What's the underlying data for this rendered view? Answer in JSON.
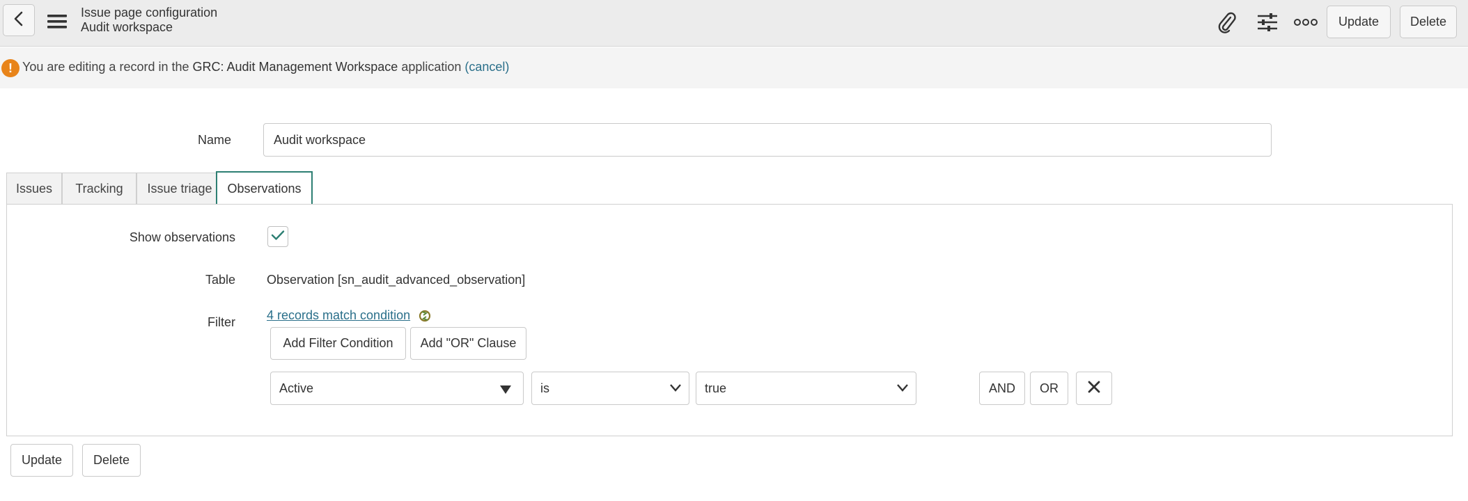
{
  "header": {
    "title": "Issue page configuration",
    "subtitle": "Audit workspace",
    "update_label": "Update",
    "delete_label": "Delete"
  },
  "notice": {
    "prefix": "You are editing a record in the ",
    "app_name": "GRC: Audit Management Workspace",
    "suffix": " application ",
    "cancel_label": "(cancel)"
  },
  "form": {
    "name_label": "Name",
    "name_value": "Audit workspace"
  },
  "tabs": [
    {
      "label": "Issues"
    },
    {
      "label": "Tracking"
    },
    {
      "label": "Issue triage"
    },
    {
      "label": "Observations"
    }
  ],
  "observations": {
    "show_label": "Show observations",
    "show_checked": true,
    "table_label": "Table",
    "table_value": "Observation [sn_audit_advanced_observation]",
    "filter_label": "Filter",
    "match_link": "4 records match condition",
    "add_filter_label": "Add Filter Condition",
    "add_or_label": "Add \"OR\" Clause",
    "condition": {
      "field": "Active",
      "operator": "is",
      "value": "true",
      "and_label": "AND",
      "or_label": "OR"
    }
  },
  "footer": {
    "update_label": "Update",
    "delete_label": "Delete"
  },
  "colors": {
    "accent": "#2d7f73",
    "link": "#2a6f8a",
    "warning": "#e8841a"
  }
}
